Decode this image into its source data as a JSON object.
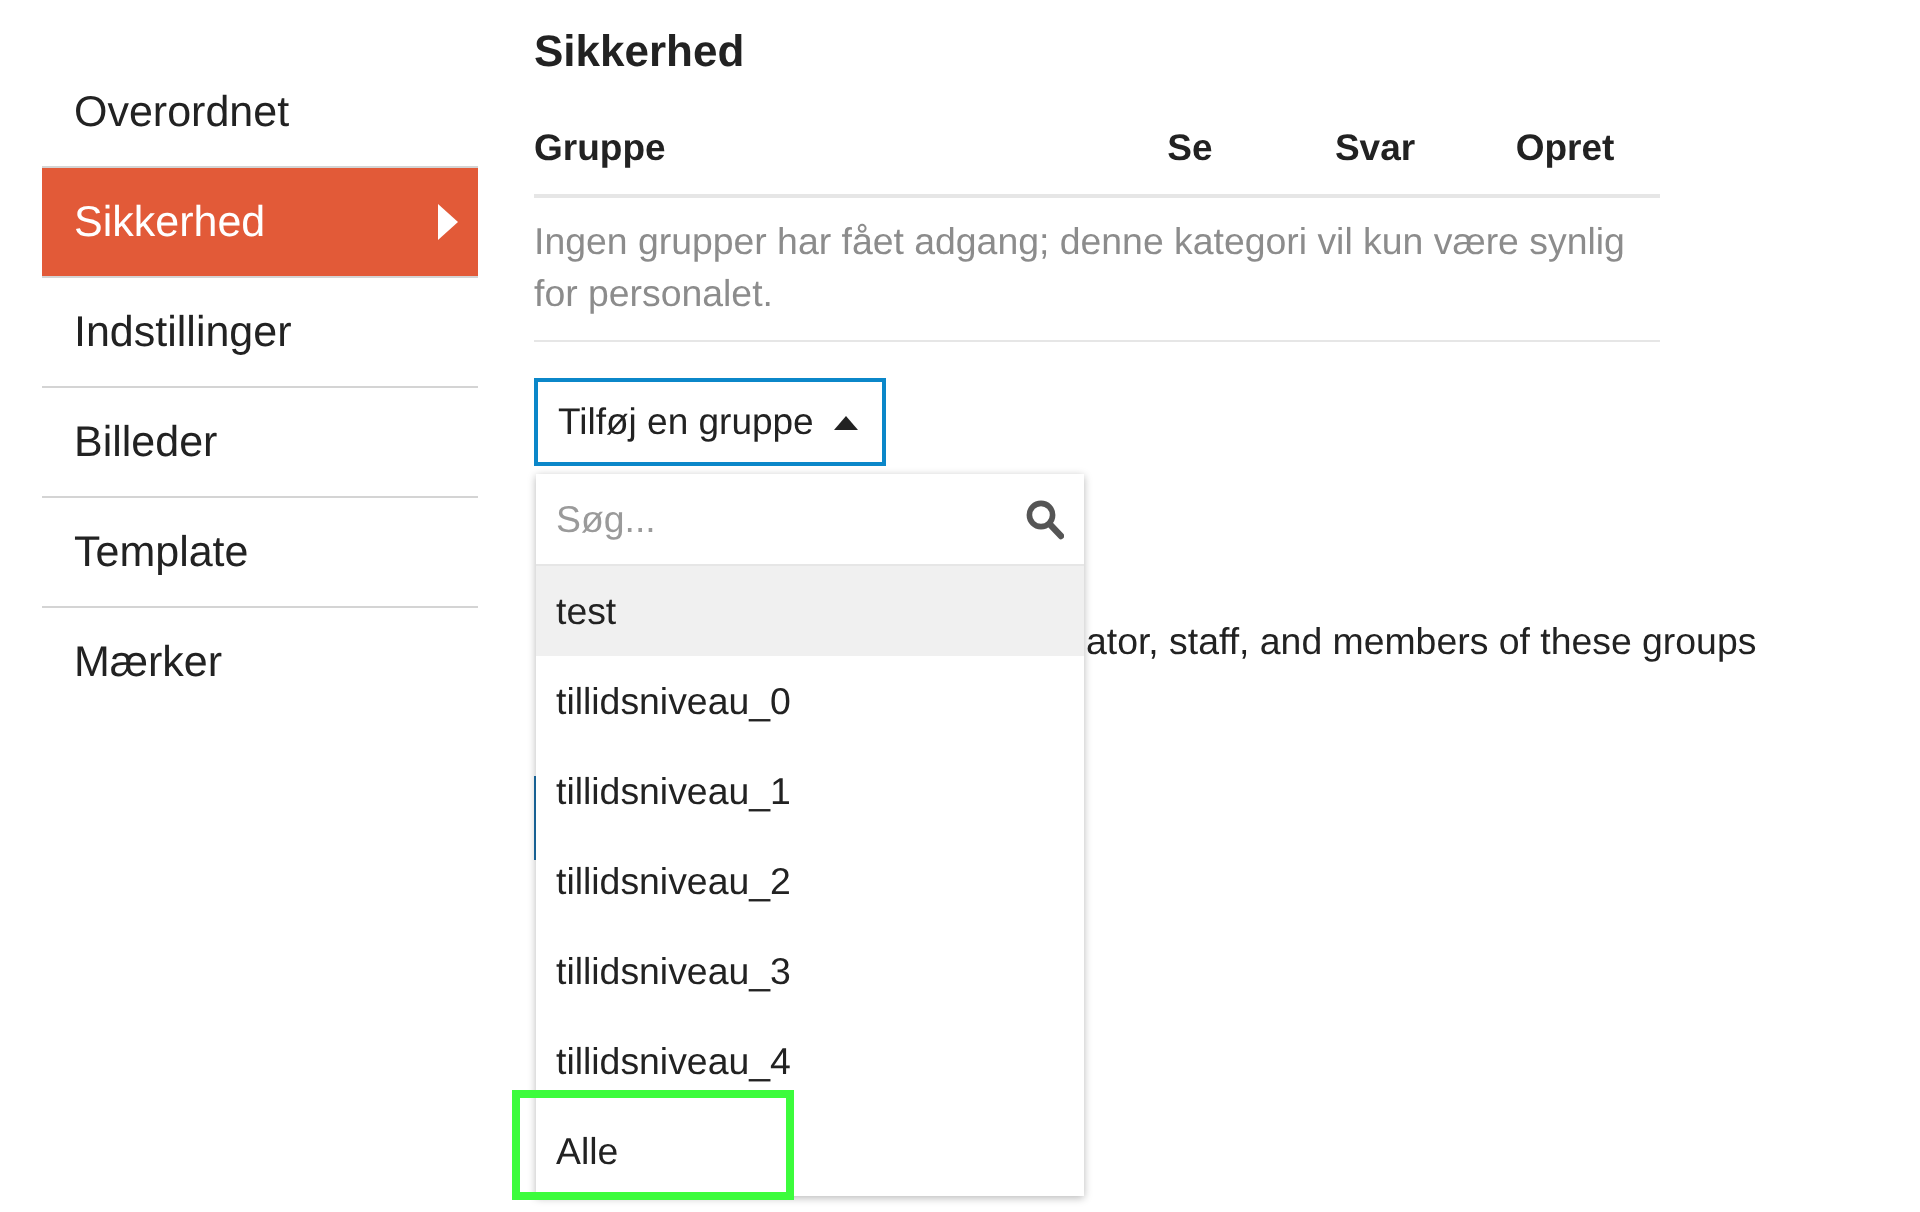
{
  "sidebar": {
    "items": [
      {
        "label": "Overordnet",
        "selected": false
      },
      {
        "label": "Sikkerhed",
        "selected": true
      },
      {
        "label": "Indstillinger",
        "selected": false
      },
      {
        "label": "Billeder",
        "selected": false
      },
      {
        "label": "Template",
        "selected": false
      },
      {
        "label": "Mærker",
        "selected": false
      }
    ]
  },
  "security": {
    "title": "Sikkerhed",
    "table": {
      "columns": [
        "Gruppe",
        "Se",
        "Svar",
        "Opret"
      ],
      "empty_message": "Ingen grupper har fået adgang; denne kategori vil kun være synlig for personalet."
    },
    "add_group_button": {
      "label": "Tilføj en gruppe",
      "expanded": true
    },
    "help_text": "ator, staff, and members of these groups"
  },
  "dropdown": {
    "search": {
      "placeholder": "Søg..."
    },
    "options": [
      {
        "label": "test",
        "highlighted": true,
        "outlined": false
      },
      {
        "label": "tillidsniveau_0",
        "highlighted": false,
        "outlined": false
      },
      {
        "label": "tillidsniveau_1",
        "highlighted": false,
        "outlined": false
      },
      {
        "label": "tillidsniveau_2",
        "highlighted": false,
        "outlined": false
      },
      {
        "label": "tillidsniveau_3",
        "highlighted": false,
        "outlined": false
      },
      {
        "label": "tillidsniveau_4",
        "highlighted": false,
        "outlined": false
      },
      {
        "label": "Alle",
        "highlighted": false,
        "outlined": true
      }
    ]
  }
}
